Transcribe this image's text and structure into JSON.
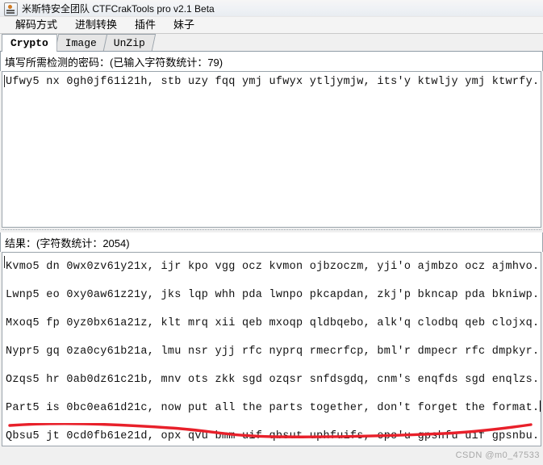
{
  "window": {
    "title": "米斯特安全团队 CTFCrakTools pro v2.1 Beta",
    "icon": "app-icon"
  },
  "menubar": {
    "items": [
      {
        "label": "解码方式"
      },
      {
        "label": "进制转换"
      },
      {
        "label": "插件"
      },
      {
        "label": "妹子"
      }
    ]
  },
  "tabs": [
    {
      "label": "Crypto",
      "selected": true
    },
    {
      "label": "Image",
      "selected": false
    },
    {
      "label": "UnZip",
      "selected": false
    }
  ],
  "input_panel": {
    "label": "填写所需检测的密码：(已输入字符数统计：79)",
    "value": "Ufwy5 nx 0gh0jf61i21h, stb uzy fqq ymj ufwyx ytljymjw, its'y ktwljy ymj ktwrfy."
  },
  "output_panel": {
    "label": "结果：(字符数统计：2054)",
    "lines": [
      "Kvmo5 dn 0wx0zv61y21x, ijr kpo vgg ocz kvmon ojbzoczm, yji'o ajmbzo ocz ajmhvo.",
      "Lwnp5 eo 0xy0aw61z21y, jks lqp whh pda lwnpo pkcapdan, zkj'p bkncap pda bkniwp.",
      "Mxoq5 fp 0yz0bx61a21z, klt mrq xii qeb mxoqp qldbqebo, alk'q clodbq qeb clojxq.",
      "Nypr5 gq 0za0cy61b21a, lmu nsr yjj rfc nyprq rmecrfcp, bml'r dmpecr rfc dmpkyr.",
      "Ozqs5 hr 0ab0dz61c21b, mnv ots zkk sgd ozqsr snfdsgdq, cnm's enqfds sgd enqlzs.",
      "Part5 is 0bc0ea61d21c, now put all the parts together, don't forget the format.",
      "Qbsu5 jt 0cd0fb61e21d, opx qvu bmm uif qbsut uphfuifs, epo'u gpshfu uif gpsnbu."
    ]
  },
  "annotation": {
    "color": "#e8202a",
    "name": "red-underline-highlight"
  },
  "watermark": {
    "text": "CSDN @m0_47533"
  }
}
